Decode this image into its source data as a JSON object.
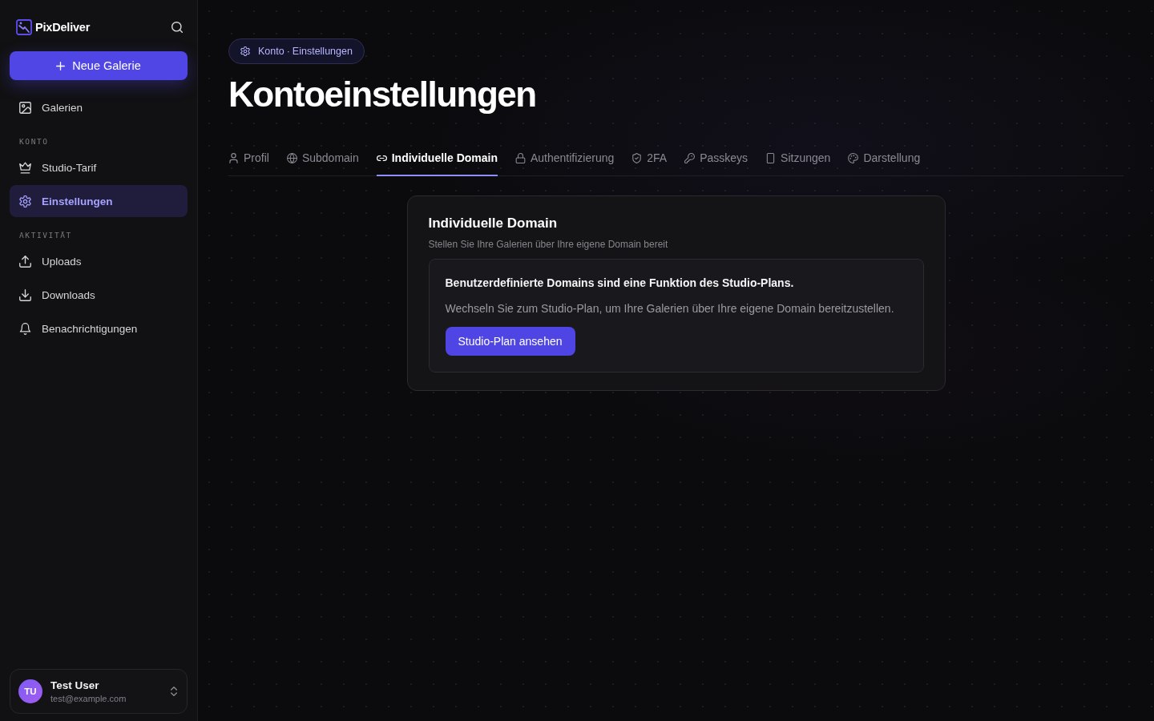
{
  "sidebar": {
    "brand": "PixDeliver",
    "new_gallery_button": "Neue Galerie",
    "sections": [
      {
        "items": [
          {
            "label": "Galerien",
            "selected": false
          }
        ]
      },
      {
        "heading": "KONTO",
        "items": [
          {
            "label": "Studio-Tarif",
            "selected": false
          },
          {
            "label": "Einstellungen",
            "selected": true
          }
        ]
      },
      {
        "heading": "AKTIVITÄT",
        "items": [
          {
            "label": "Uploads",
            "selected": false
          },
          {
            "label": "Downloads",
            "selected": false
          },
          {
            "label": "Benachrichtigungen",
            "selected": false
          }
        ]
      }
    ],
    "user": {
      "initials": "TU",
      "name": "Test User",
      "email": "test@example.com"
    }
  },
  "header": {
    "breadcrumb": [
      "Konto",
      "Einstellungen"
    ],
    "breadcrumb_separator": "·",
    "title": "Kontoeinstellungen"
  },
  "tabs": [
    {
      "label": "Profil",
      "selected": false
    },
    {
      "label": "Subdomain",
      "selected": false
    },
    {
      "label": "Individuelle Domain",
      "selected": true
    },
    {
      "label": "Authentifizierung",
      "selected": false
    },
    {
      "label": "2FA",
      "selected": false
    },
    {
      "label": "Passkeys",
      "selected": false
    },
    {
      "label": "Sitzungen",
      "selected": false
    },
    {
      "label": "Darstellung",
      "selected": false
    }
  ],
  "card": {
    "title": "Individuelle Domain",
    "subtitle": "Stellen Sie Ihre Galerien über Ihre eigene Domain bereit",
    "notice": {
      "heading": "Benutzerdefinierte Domains sind eine Funktion des Studio-Plans.",
      "text": "Wechseln Sie zum Studio-Plan, um Ihre Galerien über Ihre eigene Domain bereitzustellen.",
      "button": "Studio-Plan ansehen"
    }
  }
}
